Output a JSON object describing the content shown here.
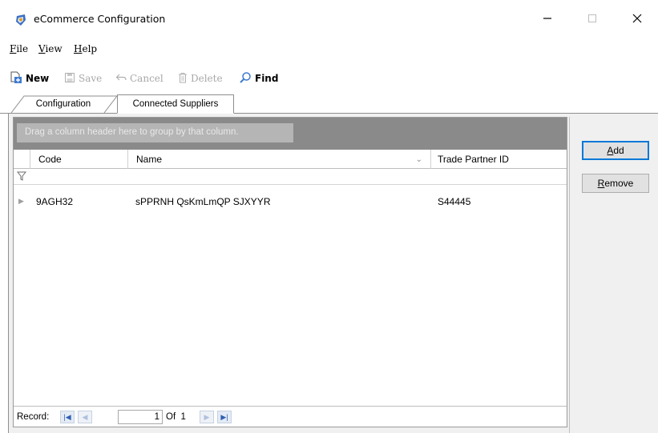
{
  "window": {
    "title": "eCommerce Configuration",
    "app_icon": "app-logo-icon",
    "controls": [
      "minimize-icon",
      "maximize-icon",
      "close-icon"
    ]
  },
  "menu": [
    {
      "accel": "F",
      "rest": "ile"
    },
    {
      "accel": "V",
      "rest": "iew"
    },
    {
      "accel": "H",
      "rest": "elp"
    }
  ],
  "toolbar": {
    "new_label": "New",
    "save_label": "Save",
    "cancel_label": "Cancel",
    "delete_label": "Delete",
    "find_label": "Find"
  },
  "tabs": [
    {
      "label": "Configuration",
      "active": false
    },
    {
      "label": "Connected Suppliers",
      "active": true
    }
  ],
  "grid": {
    "group_hint": "Drag a column header here to group by that column.",
    "columns": [
      "Code",
      "Name",
      "Trade Partner ID"
    ],
    "rows": [
      {
        "code": "9AGH32",
        "name": "sPPRNH QsKmLmQP SJXYYR",
        "trade_partner_id": "S44445"
      }
    ]
  },
  "record_nav": {
    "label": "Record:",
    "current": "1",
    "of_text": "Of",
    "total": "1"
  },
  "side_buttons": {
    "add": {
      "accel": "A",
      "rest": "dd"
    },
    "remove": {
      "accel": "R",
      "rest": "emove"
    }
  },
  "colors": {
    "group_panel": "#8a8a8a",
    "nav_accent": "#2f5fb3",
    "default_button_border": "#0078d7"
  }
}
